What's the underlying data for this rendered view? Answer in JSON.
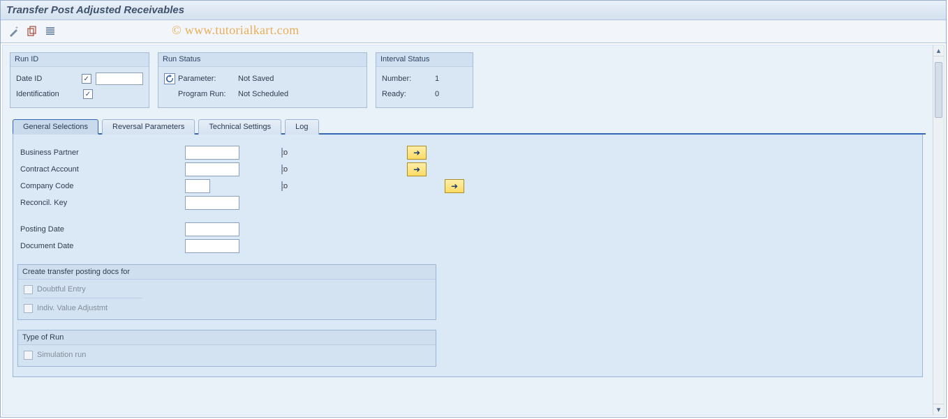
{
  "title": "Transfer Post Adjusted Receivables",
  "watermark": "© www.tutorialkart.com",
  "groups": {
    "runid": {
      "title": "Run ID",
      "date_label": "Date ID",
      "ident_label": "Identification"
    },
    "runstatus": {
      "title": "Run Status",
      "param_label": "Parameter:",
      "param_value": "Not Saved",
      "progrun_label": "Program Run:",
      "progrun_value": "Not Scheduled"
    },
    "interval": {
      "title": "Interval Status",
      "number_label": "Number:",
      "number_value": "1",
      "ready_label": "Ready:",
      "ready_value": "0"
    }
  },
  "tabs": {
    "t0": "General Selections",
    "t1": "Reversal Parameters",
    "t2": "Technical Settings",
    "t3": "Log"
  },
  "form": {
    "bp_label": "Business Partner",
    "ca_label": "Contract Account",
    "cc_label": "Company Code",
    "rk_label": "Reconcil. Key",
    "pd_label": "Posting Date",
    "dd_label": "Document Date",
    "to": "to"
  },
  "inner1": {
    "title": "Create transfer posting docs for",
    "opt1": "Doubtful Entry",
    "opt2": "Indiv. Value Adjustmt"
  },
  "inner2": {
    "title": "Type of Run",
    "opt1": "Simulation run"
  }
}
